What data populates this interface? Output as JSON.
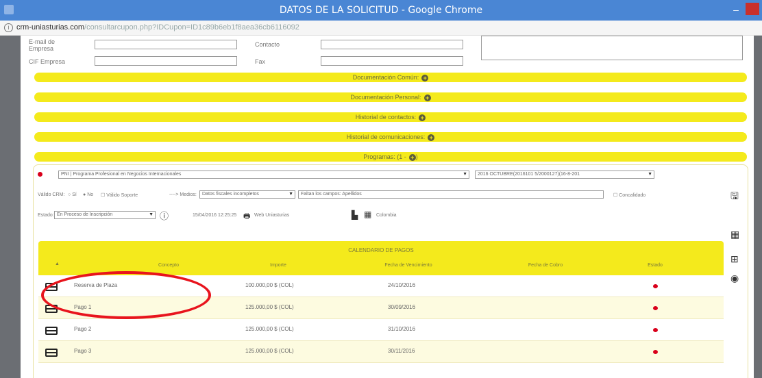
{
  "window": {
    "title": "DATOS DE LA SOLICITUD - Google Chrome",
    "minimize": "–"
  },
  "urlbar": {
    "host": "crm-uniasturias.com",
    "path": "/consultarcupon.php?IDCupon=ID1c89b6eb1f8aea36cb6116092"
  },
  "form": {
    "email_label": "E-mail de Empresa",
    "contact_label": "Contacto",
    "cif_label": "CIF Empresa",
    "fax_label": "Fax"
  },
  "sections": [
    {
      "label": "Documentación Común:"
    },
    {
      "label": "Documentación Personal:"
    },
    {
      "label": "Historial de contactos:"
    },
    {
      "label": "Historial de comunicaciones:"
    },
    {
      "label": "Programas: (1 -"
    }
  ],
  "program": {
    "program_select": "PNI | Programa Profesional en Negocios Internacionales",
    "edition_select": "2016 OCTUBRE(2016101 5/2000127)(16-8-201",
    "valido_crm_label": "Válido CRM:",
    "si_label": "Sí",
    "no_label": "No",
    "valido_soporte_label": "Válido Soporte",
    "medios_label": "----> Medios:",
    "medios_select": "Datos fiscales incompletos",
    "faltan_text": "Faltan los campos: Apellidos",
    "concalidado_label": "Concalidado",
    "estado_label": "Estado:",
    "estado_select": "En Proceso de Inscripción",
    "timestamp": "15/04/2016 12:25:25",
    "web_label": "Web Uniasturias",
    "country": "Colombia"
  },
  "payments": {
    "caption": "CALENDARIO DE PAGOS",
    "columns": [
      "Concepto",
      "Importe",
      "Fecha de Vencimiento",
      "Fecha de Cobro",
      "Estado"
    ],
    "rows": [
      {
        "concepto": "Reserva de Plaza",
        "importe": "100.000,00 $ (COL)",
        "vencimiento": "24/10/2016",
        "cobro": ""
      },
      {
        "concepto": "Pago 1",
        "importe": "125.000,00 $ (COL)",
        "vencimiento": "30/09/2016",
        "cobro": ""
      },
      {
        "concepto": "Pago 2",
        "importe": "125.000,00 $ (COL)",
        "vencimiento": "31/10/2016",
        "cobro": ""
      },
      {
        "concepto": "Pago 3",
        "importe": "125.000,00 $ (COL)",
        "vencimiento": "30/11/2016",
        "cobro": ""
      }
    ]
  },
  "icons": {
    "save": "save-icon",
    "calendar": "calendar-icon",
    "calendar_add": "calendar-add-icon",
    "view": "eye-icon",
    "plus": "plus-circle-icon",
    "card": "credit-card-icon"
  },
  "colors": {
    "accent_yellow": "#f4ea1c",
    "title_blue": "#4a86d4",
    "status_red": "#d9001b",
    "annotation_red": "#e8141d"
  }
}
